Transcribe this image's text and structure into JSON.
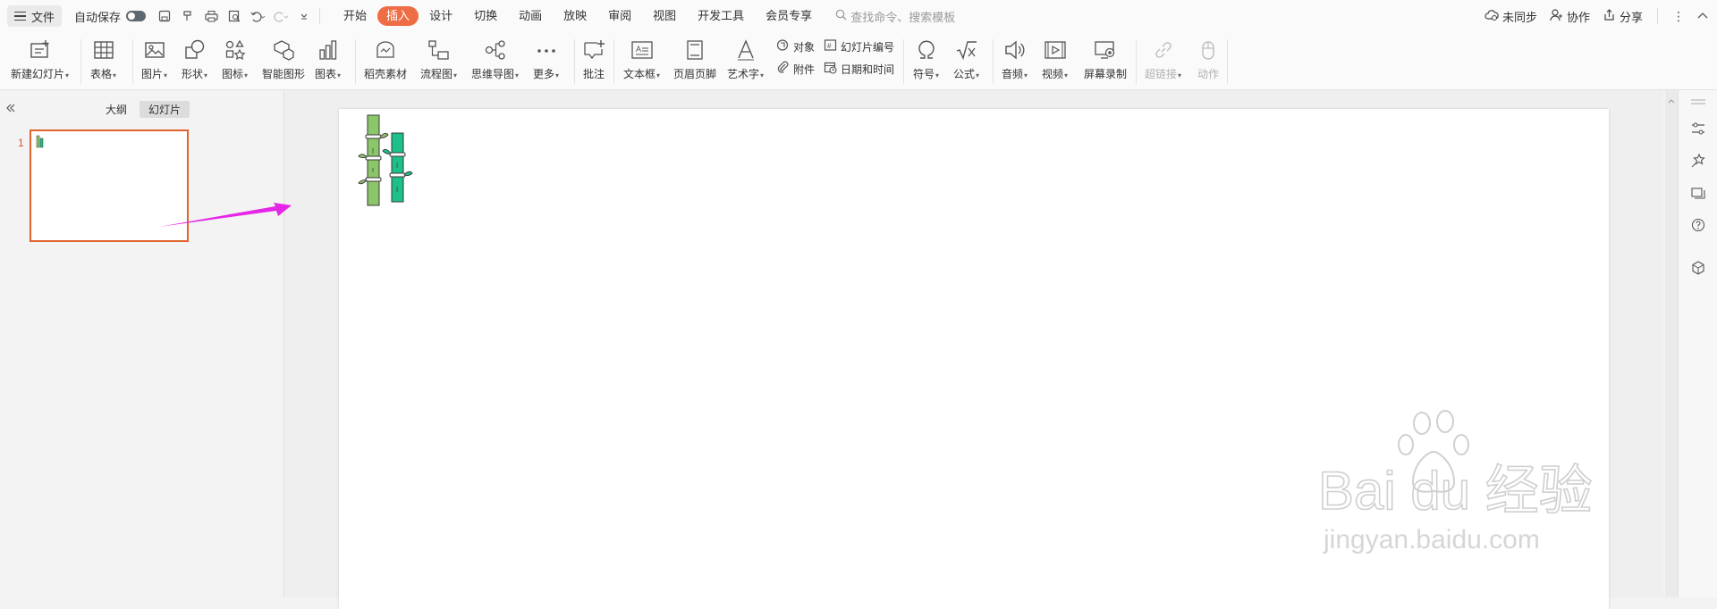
{
  "menubar": {
    "file_label": "文件",
    "autosave_label": "自动保存",
    "tabs": [
      {
        "label": "开始"
      },
      {
        "label": "插入"
      },
      {
        "label": "设计"
      },
      {
        "label": "切换"
      },
      {
        "label": "动画"
      },
      {
        "label": "放映"
      },
      {
        "label": "审阅"
      },
      {
        "label": "视图"
      },
      {
        "label": "开发工具"
      },
      {
        "label": "会员专享"
      }
    ],
    "active_tab": "插入",
    "search_placeholder": "查找命令、搜索模板",
    "sync_label": "未同步",
    "collab_label": "协作",
    "share_label": "分享"
  },
  "ribbon": {
    "new_slide": "新建幻灯片",
    "table": "表格",
    "picture": "图片",
    "shape": "形状",
    "icon": "图标",
    "smart_graphic": "智能图形",
    "chart": "图表",
    "docer_material": "稻壳素材",
    "flowchart": "流程图",
    "mindmap": "思维导图",
    "more": "更多",
    "comment": "批注",
    "textbox": "文本框",
    "header_footer": "页眉页脚",
    "wordart": "艺术字",
    "object": "对象",
    "attachment": "附件",
    "slide_number": "幻灯片编号",
    "datetime": "日期和时间",
    "symbol": "符号",
    "formula": "公式",
    "audio": "音频",
    "video": "视频",
    "screen_record": "屏幕录制",
    "hyperlink": "超链接",
    "action": "动作"
  },
  "leftpanel": {
    "outline_tab": "大纲",
    "slides_tab": "幻灯片",
    "slide_number": "1"
  },
  "watermark": {
    "brand": "Bai du 经验",
    "url": "jingyan.baidu.com"
  },
  "colors": {
    "accent": "#ef6d45",
    "thumb_border": "#e0622d",
    "arrow": "#e626e6",
    "bamboo_light": "#8cc66a",
    "bamboo_teal": "#1cc08a"
  }
}
